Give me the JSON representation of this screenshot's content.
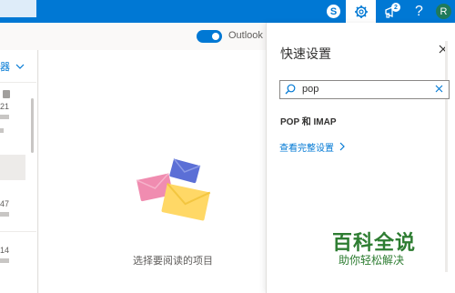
{
  "topbar": {
    "skype_letter": "S",
    "notification_count": "2",
    "help_glyph": "?",
    "avatar_letter": "R"
  },
  "toolbar": {
    "outlook_toggle_label": "Outlook"
  },
  "message_list": {
    "filter_label": "器",
    "items": [
      {
        "num": "21"
      },
      {
        "num": "47"
      },
      {
        "num": "14"
      }
    ]
  },
  "reading_pane": {
    "empty_text": "选择要阅读的项目"
  },
  "quick_settings": {
    "title": "快速设置",
    "search_value": "pop",
    "result_label": "POP 和 IMAP",
    "full_settings_link": "查看完整设置"
  },
  "watermark": {
    "title": "百科全说",
    "subtitle": "助你轻松解决"
  },
  "colors": {
    "brand": "#0078d4",
    "watermark": "#2e7d32"
  }
}
